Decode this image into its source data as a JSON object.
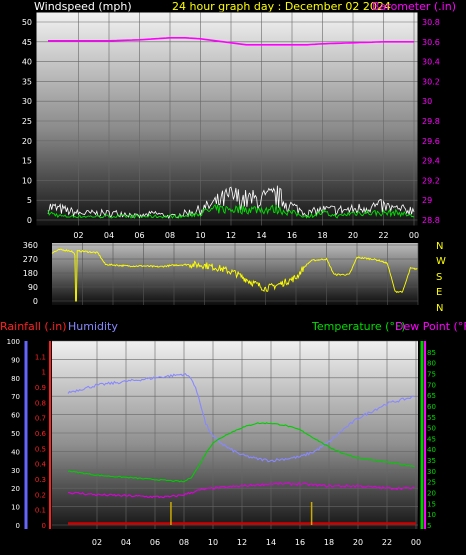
{
  "header": {
    "wind_label": "Windspeed (mph)",
    "title": "24 hour graph day : December 02 2024",
    "baro_label": "Barometer (.in)"
  },
  "footer": {
    "rain_label": "Rainfall (.in)",
    "humidity_label": "Humidity",
    "temp_label": "Temperature (°F)",
    "dew_label": "Dew Point (°F)"
  },
  "compass": [
    "N",
    "W",
    "S",
    "E",
    "N"
  ],
  "colors": {
    "background": "#000000",
    "title": "#ffff00",
    "wind_avg": "#00e000",
    "wind_gust": "#ffffff",
    "barometer": "#ff00ff",
    "direction": "#ffff00",
    "humidity": "#8888ff",
    "temperature": "#00cc00",
    "dewpoint": "#dd00dd",
    "rain": "#cc0000",
    "rain_rate": "#ccaa00"
  },
  "chart_data": [
    {
      "type": "line",
      "title": "24 hour graph day : December 02 2024",
      "x_ticks": [
        "02",
        "04",
        "06",
        "08",
        "10",
        "12",
        "14",
        "16",
        "18",
        "20",
        "22",
        "00"
      ],
      "y_left": {
        "label": "Windspeed (mph)",
        "ylim": [
          0,
          50
        ],
        "ticks": [
          "0",
          "5",
          "10",
          "15",
          "20",
          "25",
          "30",
          "35",
          "40",
          "45",
          "50"
        ]
      },
      "y_right": {
        "label": "Barometer (.in)",
        "ylim": [
          28.8,
          30.8
        ],
        "ticks": [
          "28.8",
          "29",
          "29.2",
          "29.4",
          "29.6",
          "29.8",
          "30",
          "30.2",
          "30.4",
          "30.6",
          "30.8"
        ]
      },
      "series": [
        {
          "name": "Barometer (.in)",
          "axis": "right",
          "x": [
            0,
            2,
            4,
            6,
            7,
            8,
            9,
            10,
            11,
            12,
            13,
            14,
            15,
            16,
            17,
            18,
            20,
            22,
            24
          ],
          "values": [
            30.61,
            30.61,
            30.61,
            30.62,
            30.63,
            30.64,
            30.64,
            30.63,
            30.61,
            30.59,
            30.57,
            30.57,
            30.57,
            30.57,
            30.57,
            30.58,
            30.59,
            30.6,
            30.6
          ]
        },
        {
          "name": "",
          "axis": "left",
          "kind": "gust",
          "x": [
            0,
            1,
            2,
            3,
            4,
            5,
            6,
            7,
            8,
            9,
            10,
            11,
            12,
            13,
            14,
            15,
            16,
            17,
            18,
            19,
            20,
            21,
            22,
            23,
            24
          ],
          "values": [
            4,
            3,
            2,
            2,
            2,
            2,
            1,
            2,
            1,
            2,
            3,
            5,
            7,
            6,
            6,
            7,
            4,
            2,
            3,
            3,
            3,
            4,
            4,
            3,
            3
          ]
        },
        {
          "name": "",
          "axis": "left",
          "kind": "average",
          "x": [
            0,
            1,
            2,
            3,
            4,
            5,
            6,
            7,
            8,
            9,
            10,
            11,
            12,
            13,
            14,
            15,
            16,
            17,
            18,
            19,
            20,
            21,
            22,
            23,
            24
          ],
          "values": [
            2,
            1,
            1,
            1,
            1,
            1,
            1,
            1,
            1,
            1,
            2,
            3,
            3,
            3,
            3,
            3,
            2,
            1,
            2,
            1,
            2,
            2,
            2,
            2,
            1
          ]
        }
      ]
    },
    {
      "type": "line",
      "title": "",
      "y_left": {
        "ylim": [
          0,
          360
        ],
        "ticks": [
          "0",
          "90",
          "180",
          "270",
          "360"
        ]
      },
      "series": [
        {
          "name": "",
          "axis": "left",
          "x": [
            0,
            0.5,
            1,
            1.3,
            1.5,
            1.55,
            1.6,
            1.65,
            2,
            3,
            3.5,
            5,
            6,
            7,
            8,
            9,
            10,
            11,
            12,
            13,
            14,
            15,
            16,
            16.5,
            17,
            18,
            18.5,
            19.5,
            20,
            21,
            21.5,
            22,
            22.5,
            23,
            23.5,
            24
          ],
          "values": [
            310,
            330,
            325,
            320,
            300,
            0,
            0,
            320,
            320,
            310,
            235,
            225,
            225,
            220,
            230,
            235,
            230,
            210,
            180,
            125,
            80,
            110,
            150,
            215,
            260,
            270,
            170,
            170,
            280,
            270,
            260,
            240,
            60,
            60,
            210,
            205
          ]
        }
      ]
    },
    {
      "type": "line",
      "title": "",
      "x_ticks": [
        "02",
        "04",
        "06",
        "08",
        "10",
        "12",
        "14",
        "16",
        "18",
        "20",
        "22",
        "00"
      ],
      "y_left": {
        "label": "Humidity",
        "ylim": [
          0,
          100
        ],
        "ticks": [
          "0",
          "10",
          "20",
          "30",
          "40",
          "50",
          "60",
          "70",
          "80",
          "90",
          "100"
        ]
      },
      "y_left_inner": {
        "label": "Rainfall (.in)",
        "ylim": [
          0,
          1.2
        ],
        "ticks": [
          "0",
          "0.1",
          "0.2",
          "0.3",
          "0.4",
          "0.5",
          "0.6",
          "0.7",
          "0.8",
          "0.9",
          "1",
          "1.1"
        ]
      },
      "y_right": {
        "label": "Temperature (°F)",
        "ylim": [
          5,
          90
        ],
        "ticks": [
          "5",
          "10",
          "15",
          "20",
          "25",
          "30",
          "35",
          "40",
          "45",
          "50",
          "55",
          "60",
          "65",
          "70",
          "75",
          "80",
          "85"
        ]
      },
      "series": [
        {
          "name": "Humidity",
          "axis": "left",
          "x": [
            0,
            1,
            2,
            3,
            4,
            5,
            6,
            7,
            8,
            8.5,
            9,
            9.5,
            10,
            11,
            12,
            13,
            14,
            15,
            16,
            17,
            18,
            19,
            20,
            21,
            22,
            23,
            24
          ],
          "values": [
            72,
            74,
            76,
            77,
            78,
            79,
            80,
            81,
            82,
            80,
            70,
            55,
            48,
            42,
            38,
            36,
            35,
            36,
            37,
            40,
            45,
            52,
            58,
            62,
            66,
            68,
            70
          ]
        },
        {
          "name": "Temperature (°F)",
          "axis": "right",
          "x": [
            0,
            1,
            2,
            3,
            4,
            5,
            6,
            7,
            8,
            8.5,
            9,
            9.5,
            10,
            11,
            12,
            13,
            14,
            15,
            16,
            17,
            18,
            19,
            20,
            21,
            22,
            23,
            24
          ],
          "values": [
            30,
            29,
            28,
            27.5,
            27,
            26.5,
            26,
            25.5,
            25,
            27,
            32,
            38,
            43,
            47,
            50,
            52,
            52,
            51,
            49,
            45,
            41,
            38,
            36,
            35,
            34,
            33,
            32
          ]
        },
        {
          "name": "Dew Point (°F)",
          "axis": "right",
          "x": [
            0,
            2,
            4,
            6,
            7,
            8,
            8.5,
            9,
            10,
            12,
            14,
            16,
            18,
            20,
            22,
            24
          ],
          "values": [
            20,
            19,
            18.5,
            18,
            18,
            19,
            20,
            21,
            22,
            23,
            24,
            24,
            23,
            23,
            22,
            22
          ]
        },
        {
          "name": "Rainfall (.in)",
          "axis": "left_inner",
          "kind": "rain",
          "x": [
            0,
            24
          ],
          "values": [
            0.01,
            0.01
          ]
        },
        {
          "name": "",
          "axis": "left_inner",
          "kind": "rain_rate_bars",
          "x": [
            7.1,
            16.8
          ],
          "values": [
            0.15,
            0.15
          ]
        }
      ]
    }
  ]
}
